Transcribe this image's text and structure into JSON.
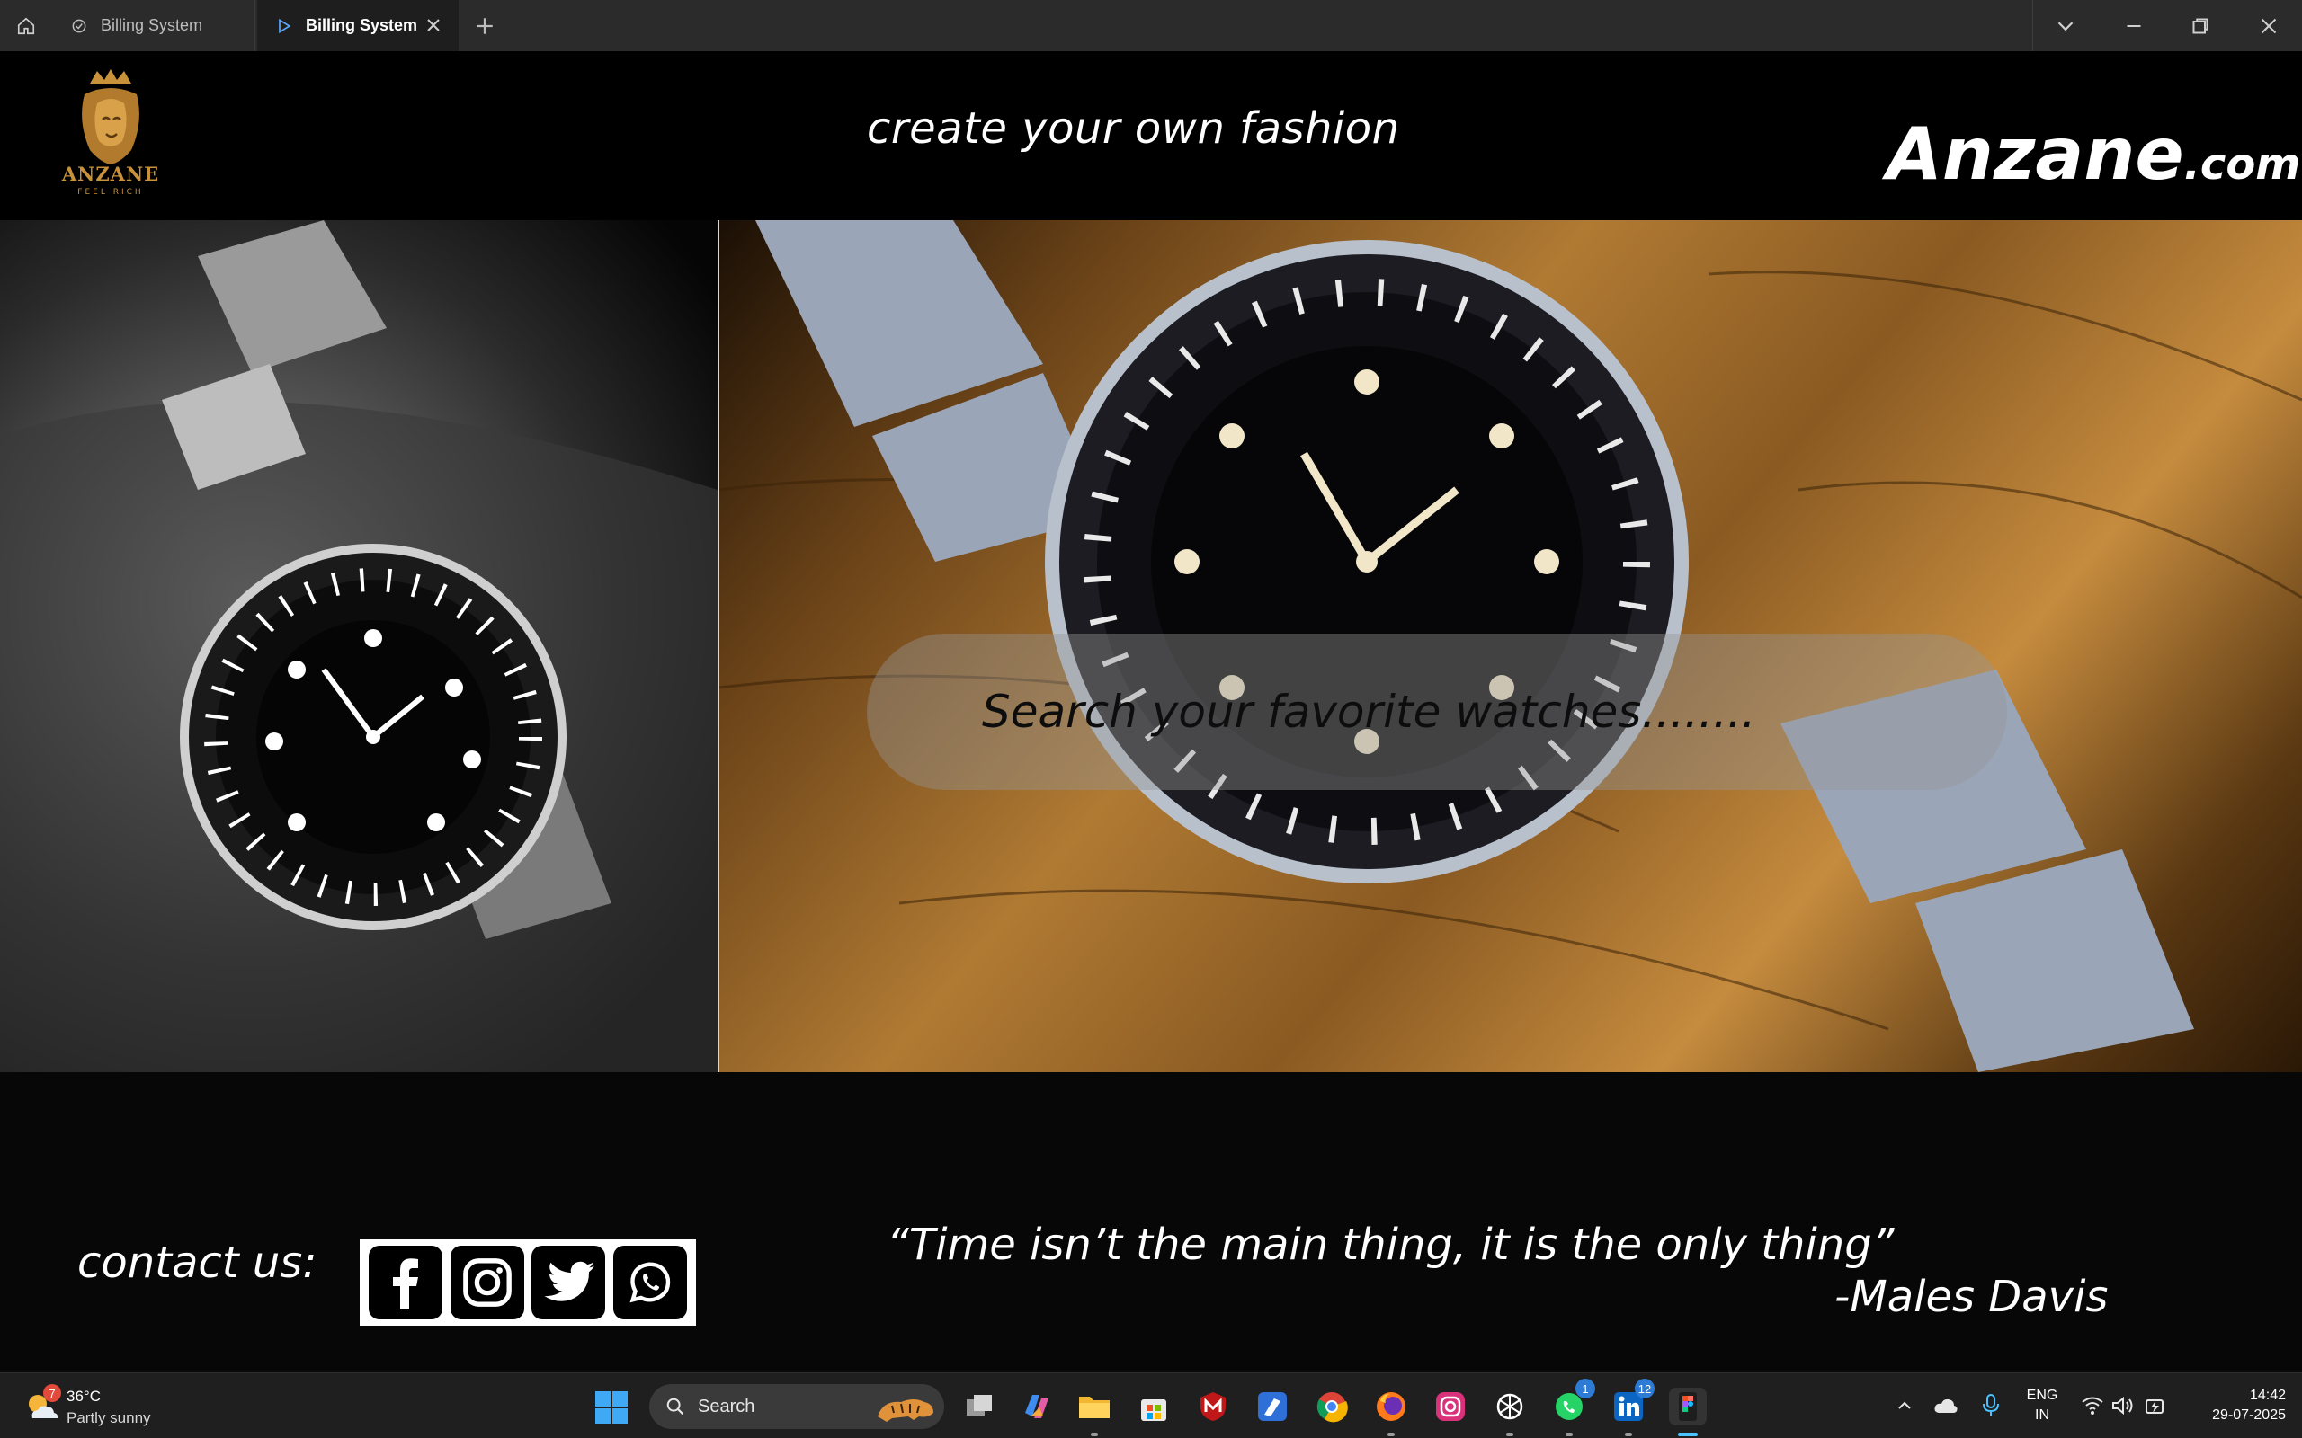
{
  "window": {
    "tabs": [
      {
        "label": "Billing System",
        "active": false
      },
      {
        "label": "Billing System",
        "active": true
      }
    ]
  },
  "header": {
    "logo_text": "ANZANE",
    "logo_subtext": "FEEL RICH",
    "tagline": "create your own fashion",
    "brand_main": "Anzane",
    "brand_suffix": ".com"
  },
  "search": {
    "placeholder": "Search your favorite watches........"
  },
  "footer": {
    "contact_label": "contact us:",
    "social": [
      "facebook-icon",
      "instagram-icon",
      "twitter-icon",
      "whatsapp-icon"
    ],
    "quote": "“Time isn’t the main thing, it is the only thing”",
    "author": "-Males Davis"
  },
  "taskbar": {
    "weather_badge": "7",
    "temperature": "36°C",
    "condition": "Partly sunny",
    "search_label": "Search",
    "whatsapp_badge": "1",
    "linkedin_badge": "12",
    "lang_line1": "ENG",
    "lang_line2": "IN",
    "time": "14:42",
    "date": "29-07-2025"
  },
  "colors": {
    "gold": "#c8923a",
    "titlebar": "#2b2b2b",
    "taskbar": "#1f1f1f",
    "accent": "#4cc2ff"
  }
}
